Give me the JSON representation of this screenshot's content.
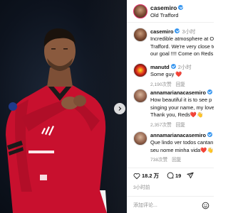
{
  "post": {
    "username": "casemiro",
    "location": "Old Trafford",
    "verified": true
  },
  "photo": {
    "description_icon": "player-photo",
    "next_icon": "chevron-right-icon"
  },
  "comments": [
    {
      "username": "casemiro",
      "verified": true,
      "time": "3小时",
      "lines": [
        "Incredible atmosphere at O",
        "Trafford. We're very close to",
        "our goal !!!! Come on Reds"
      ]
    },
    {
      "username": "manutd",
      "verified": true,
      "time": "2小时",
      "lines": [
        "Some guy ❤️"
      ],
      "likes": "2,190次赞",
      "reply": "回复"
    },
    {
      "username": "annamariana​casemiro",
      "verified": true,
      "time": "",
      "lines": [
        "How beautiful it is to see p",
        "singing your name, my love",
        "Thank you, Reds❤️👋"
      ],
      "likes": "2,357次赞",
      "reply": "回复"
    },
    {
      "username": "annamariana​casemiro",
      "verified": true,
      "time": "",
      "lines": [
        "Que lindo ver todos cantan",
        "seu nome minha vida❤️👋"
      ],
      "likes": "738次赞",
      "reply": "回复"
    }
  ],
  "actions": {
    "likes": "18.2 万",
    "comments": "19"
  },
  "posted_ago": "3小时前",
  "add_comment": {
    "placeholder": "添加评论..."
  },
  "colors": {
    "verified": "#3897f0",
    "like_red": "#ed4956",
    "jersey_red": "#c8102e"
  }
}
